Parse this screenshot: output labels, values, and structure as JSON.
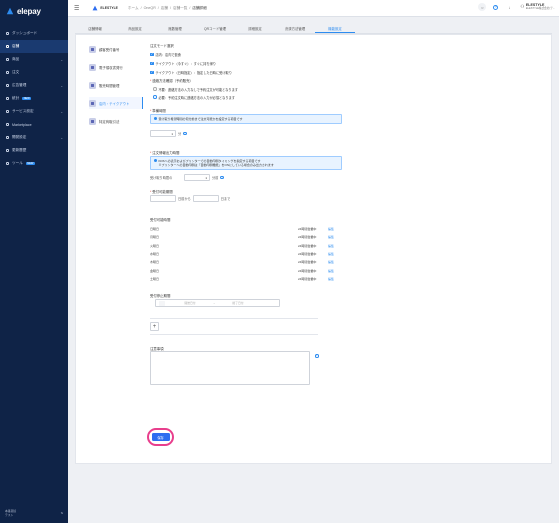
{
  "brand": {
    "name": "elepay"
  },
  "sidebar": {
    "items": [
      {
        "label": "ダッシュボード",
        "active": false,
        "badge": ""
      },
      {
        "label": "店舗",
        "active": true,
        "badge": ""
      },
      {
        "label": "商品",
        "active": false,
        "badge": "",
        "caret": "⌄"
      },
      {
        "label": "注文",
        "active": false,
        "badge": ""
      },
      {
        "label": "広告管理",
        "active": false,
        "badge": "",
        "caret": "⌄"
      },
      {
        "label": "統計",
        "active": false,
        "badge": "NEW"
      },
      {
        "label": "サービス設定",
        "active": false,
        "badge": "",
        "caret": "⌄"
      },
      {
        "label": "Marketplace",
        "active": false,
        "badge": ""
      },
      {
        "label": "開発設定",
        "active": false,
        "badge": "",
        "caret": "⌄"
      },
      {
        "label": "更新履歴",
        "active": false,
        "badge": ""
      },
      {
        "label": "ツール",
        "active": false,
        "badge": "NEW"
      }
    ],
    "footer": {
      "line1": "本番環境",
      "line2": "テスト"
    }
  },
  "topbar": {
    "shop_name": "ELESTYLE",
    "breadcrumb": [
      "ホーム",
      "/",
      "OneQR",
      "/",
      "店舗",
      "/",
      "店舗一覧",
      "/",
      "店舗詳細"
    ],
    "user": {
      "name": "ELESTYLE",
      "org": "ELESTYLE株式会社(テ..."
    }
  },
  "tabs": [
    {
      "label": "店舗情報",
      "active": false
    },
    {
      "label": "商品設定",
      "active": false
    },
    {
      "label": "席数管理",
      "active": false
    },
    {
      "label": "QRコード管理",
      "active": false
    },
    {
      "label": "詳細設定",
      "active": false
    },
    {
      "label": "決済方法管理",
      "active": false
    },
    {
      "label": "機能設定",
      "active": true
    }
  ],
  "left_menu": [
    {
      "label": "顧客受付番号",
      "active": false
    },
    {
      "label": "電子領収書発行",
      "active": false
    },
    {
      "label": "販売時間管理",
      "active": false
    },
    {
      "label": "店内・テイクアウト",
      "active": true
    },
    {
      "label": "特定商取引法",
      "active": false
    }
  ],
  "form": {
    "order_mode_label": "注文モード選択",
    "order_modes": [
      "店内：店内で飲食",
      "テイクアウト（今すぐ）：すぐに持ち帰り",
      "テイクアウト（日時指定）：指定した日時に受け取り"
    ],
    "contact_label": "連絡方法確認（予約販売）",
    "contact_options": [
      {
        "label": "不要：連絡方法の入力なしで予約注文が可能となります",
        "selected": false
      },
      {
        "label": "必要：予約注文時に連絡方法の入力が必須となります",
        "selected": true
      }
    ],
    "prep_label": "準備時間",
    "prep_info": "受け取り希望時間の何分前まで注文可能かを設定する項目です",
    "prep_value": "1",
    "prep_unit": "分",
    "print_label": "注文情報出力時間",
    "print_info_lines": [
      "KDSへの表示およびプリンターでの自動印刷タイミングを指定する項目です",
      "※プリンターへの自動印刷は「自動印刷機能」をONにしている場合のみ出力されます"
    ],
    "print_prefix": "受け取り時間の",
    "print_value": "1",
    "print_unit": "分前",
    "period_label": "受付可能期間",
    "period_after": "日前から",
    "period_until": "日まで",
    "hours_label": "受付可能時間",
    "hours": [
      {
        "day": "日曜日",
        "value": "24時間営業中",
        "action": "編集"
      },
      {
        "day": "月曜日",
        "value": "24時間営業中",
        "action": "編集"
      },
      {
        "day": "火曜日",
        "value": "24時間営業中",
        "action": "編集"
      },
      {
        "day": "水曜日",
        "value": "24時間営業中",
        "action": "編集"
      },
      {
        "day": "木曜日",
        "value": "24時間営業中",
        "action": "編集"
      },
      {
        "day": "金曜日",
        "value": "24時間営業中",
        "action": "編集"
      },
      {
        "day": "土曜日",
        "value": "24時間営業中",
        "action": "編集"
      }
    ],
    "stop_label": "受付停止期間",
    "stop_start_placeholder": "開始日付",
    "stop_sep": "→",
    "stop_end_placeholder": "終了日付",
    "notes_label": "注意事項",
    "save_label": "保存"
  }
}
